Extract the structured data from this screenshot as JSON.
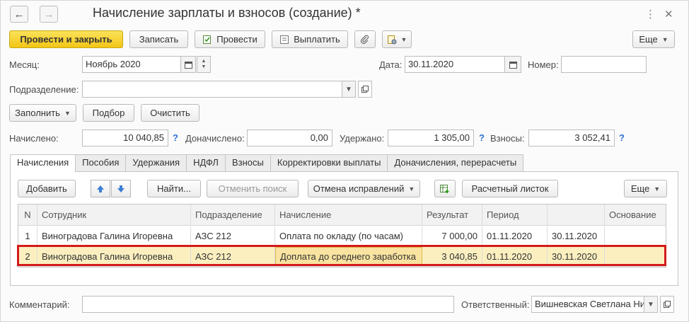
{
  "window": {
    "title": "Начисление зарплаты и взносов (создание) *",
    "back_icon": "arrow-left-icon",
    "forward_icon": "arrow-right-icon"
  },
  "toolbar": {
    "post_close": "Провести и закрыть",
    "save": "Записать",
    "post": "Провести",
    "pay": "Выплатить",
    "more": "Еще"
  },
  "header": {
    "month_label": "Месяц:",
    "month_value": "Ноябрь 2020",
    "date_label": "Дата:",
    "date_value": "30.11.2020",
    "number_label": "Номер:",
    "number_value": "",
    "department_label": "Подразделение:",
    "department_value": ""
  },
  "actions": {
    "fill": "Заполнить",
    "select": "Подбор",
    "clear": "Очистить"
  },
  "totals": {
    "accrued_label": "Начислено:",
    "accrued_value": "10 040,85",
    "additional_label": "Доначислено:",
    "additional_value": "0,00",
    "withheld_label": "Удержано:",
    "withheld_value": "1 305,00",
    "contributions_label": "Взносы:",
    "contributions_value": "3 052,41",
    "help": "?"
  },
  "tabs": [
    {
      "label": "Начисления",
      "active": true
    },
    {
      "label": "Пособия"
    },
    {
      "label": "Удержания"
    },
    {
      "label": "НДФЛ"
    },
    {
      "label": "Взносы"
    },
    {
      "label": "Корректировки выплаты"
    },
    {
      "label": "Доначисления, перерасчеты"
    }
  ],
  "table_toolbar": {
    "add": "Добавить",
    "find": "Найти...",
    "cancel_search": "Отменить поиск",
    "cancel_corrections": "Отмена исправлений",
    "payslip": "Расчетный листок",
    "more": "Еще"
  },
  "table": {
    "columns": [
      "N",
      "Сотрудник",
      "Подразделение",
      "Начисление",
      "Результат",
      "Период",
      "",
      "Основание"
    ],
    "rows": [
      [
        "1",
        "Виноградова Галина Игоревна",
        "АЗС 212",
        "Оплата по окладу (по часам)",
        "7 000,00",
        "01.11.2020",
        "30.11.2020",
        ""
      ],
      [
        "2",
        "Виноградова Галина Игоревна",
        "АЗС 212",
        "Доплата до среднего заработка",
        "3 040,85",
        "01.11.2020",
        "30.11.2020",
        ""
      ]
    ],
    "selected_row": 2
  },
  "footer": {
    "comment_label": "Комментарий:",
    "comment_value": "",
    "responsible_label": "Ответственный:",
    "responsible_value": "Вишневская Светлана Ни"
  },
  "colors": {
    "primary_button": "#f2c617",
    "selected_row": "#fbefc0",
    "highlight_border": "#d41a1a",
    "help": "#2a6fd1"
  }
}
